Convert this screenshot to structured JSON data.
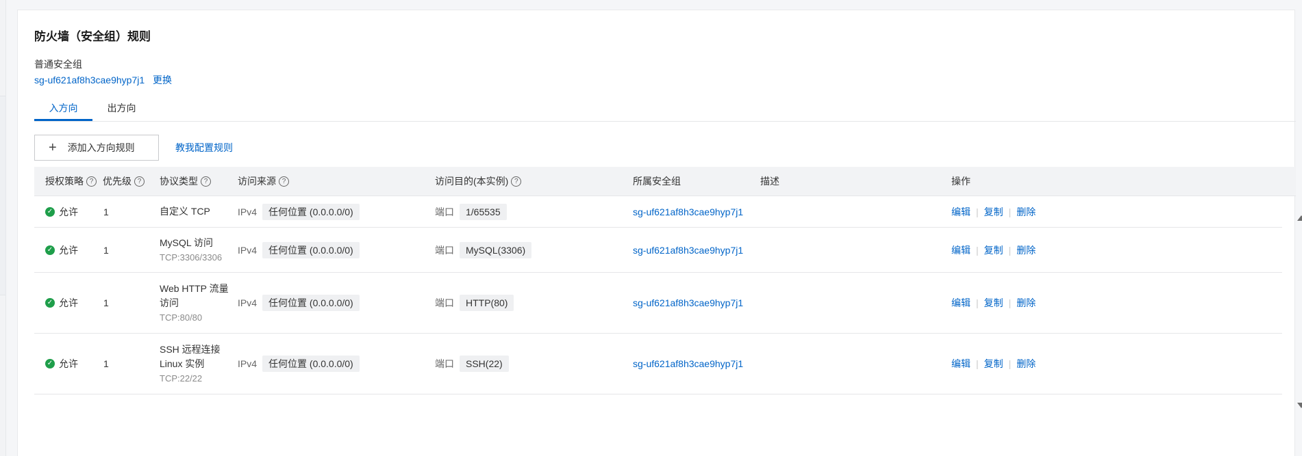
{
  "page": {
    "title": "防火墙（安全组）规则",
    "sg_type": "普通安全组",
    "sg_id": "sg-uf621af8h3cae9hyp7j1",
    "sg_change": "更换"
  },
  "tabs": [
    {
      "label": "入方向",
      "active": true
    },
    {
      "label": "出方向",
      "active": false
    }
  ],
  "actions": {
    "add_rule": "添加入方向规则",
    "teach_config": "教我配置规则"
  },
  "table": {
    "headers": {
      "policy": "授权策略",
      "priority": "优先级",
      "protocol": "协议类型",
      "source": "访问来源",
      "dest": "访问目的(本实例)",
      "sg": "所属安全组",
      "desc": "描述",
      "ops": "操作"
    },
    "rows": [
      {
        "policy": "允许",
        "priority": "1",
        "protocol": "自定义 TCP",
        "protocol_line2": "",
        "protocol_sub": "",
        "ip_version": "IPv4",
        "source": "任何位置 (0.0.0.0/0)",
        "dest_label": "端口",
        "dest": "1/65535",
        "sg": "sg-uf621af8h3cae9hyp7j1",
        "desc": ""
      },
      {
        "policy": "允许",
        "priority": "1",
        "protocol": "MySQL 访问",
        "protocol_line2": "",
        "protocol_sub": "TCP:3306/3306",
        "ip_version": "IPv4",
        "source": "任何位置 (0.0.0.0/0)",
        "dest_label": "端口",
        "dest": "MySQL(3306)",
        "sg": "sg-uf621af8h3cae9hyp7j1",
        "desc": ""
      },
      {
        "policy": "允许",
        "priority": "1",
        "protocol": "Web HTTP 流量",
        "protocol_line2": "访问",
        "protocol_sub": "TCP:80/80",
        "ip_version": "IPv4",
        "source": "任何位置 (0.0.0.0/0)",
        "dest_label": "端口",
        "dest": "HTTP(80)",
        "sg": "sg-uf621af8h3cae9hyp7j1",
        "desc": ""
      },
      {
        "policy": "允许",
        "priority": "1",
        "protocol": "SSH 远程连接",
        "protocol_line2": "Linux 实例",
        "protocol_sub": "TCP:22/22",
        "ip_version": "IPv4",
        "source": "任何位置 (0.0.0.0/0)",
        "dest_label": "端口",
        "dest": "SSH(22)",
        "sg": "sg-uf621af8h3cae9hyp7j1",
        "desc": ""
      }
    ],
    "ops": {
      "edit": "编辑",
      "copy": "复制",
      "delete": "删除"
    }
  }
}
